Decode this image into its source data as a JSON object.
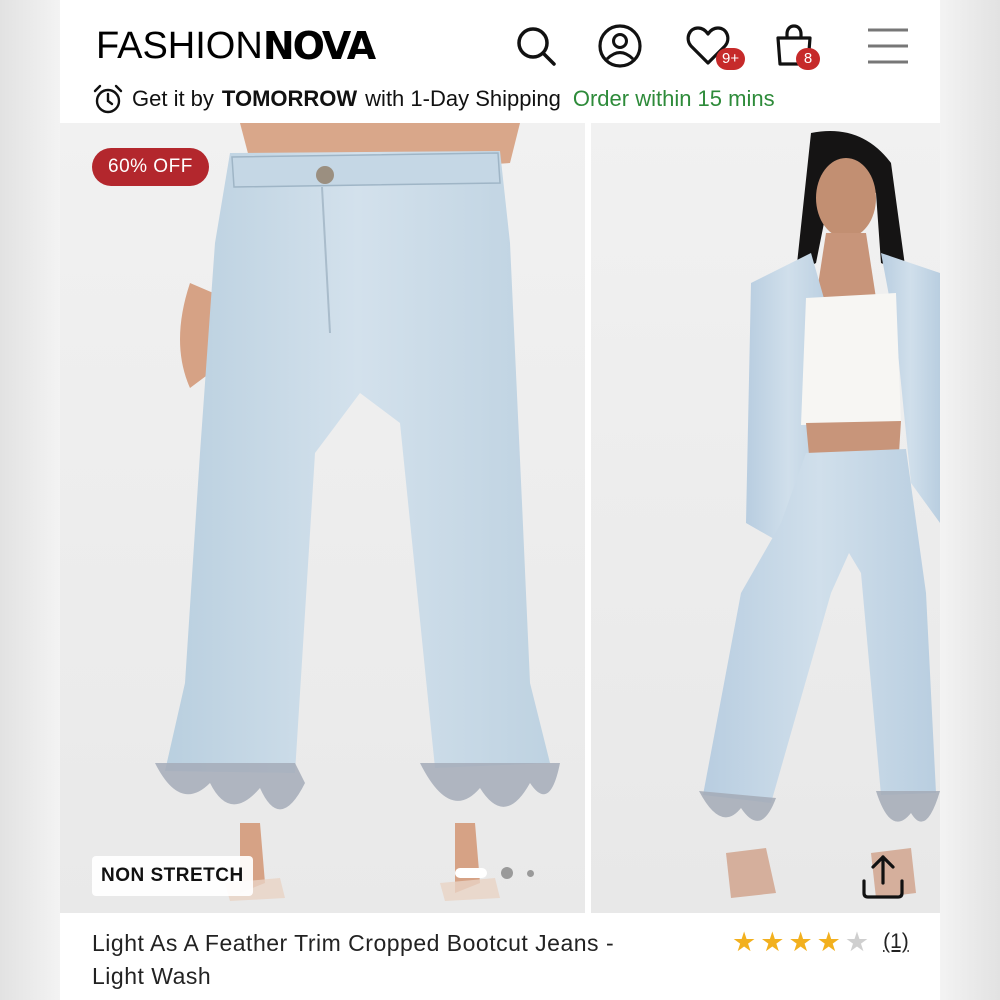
{
  "brand": {
    "part1": "FASHION",
    "part2": "NOVA"
  },
  "header_icons": {
    "wishlist_badge": "9+",
    "cart_badge": "8"
  },
  "shipping": {
    "prefix": "Get it by",
    "day": "TOMORROW",
    "suffix": "with 1-Day Shipping",
    "urgency": "Order within 15 mins"
  },
  "gallery": {
    "discount_badge": "60% OFF",
    "stretch_tag": "NON STRETCH",
    "slide_count": 3,
    "active_slide": 1
  },
  "product": {
    "title": "Light As A Feather Trim Cropped Bootcut Jeans - Light Wash",
    "rating": 4,
    "rating_max": 5,
    "review_count": "(1)"
  },
  "colors": {
    "sale_red": "#b3272d",
    "badge_red": "#c62a2a",
    "urgency_green": "#2e8b3a",
    "star_gold": "#f2b01e",
    "denim": "#c4d6e4"
  },
  "icons": [
    "search-icon",
    "account-icon",
    "wishlist-heart-icon",
    "shopping-bag-icon",
    "menu-icon",
    "alarm-clock-icon",
    "share-icon",
    "star-icon"
  ]
}
